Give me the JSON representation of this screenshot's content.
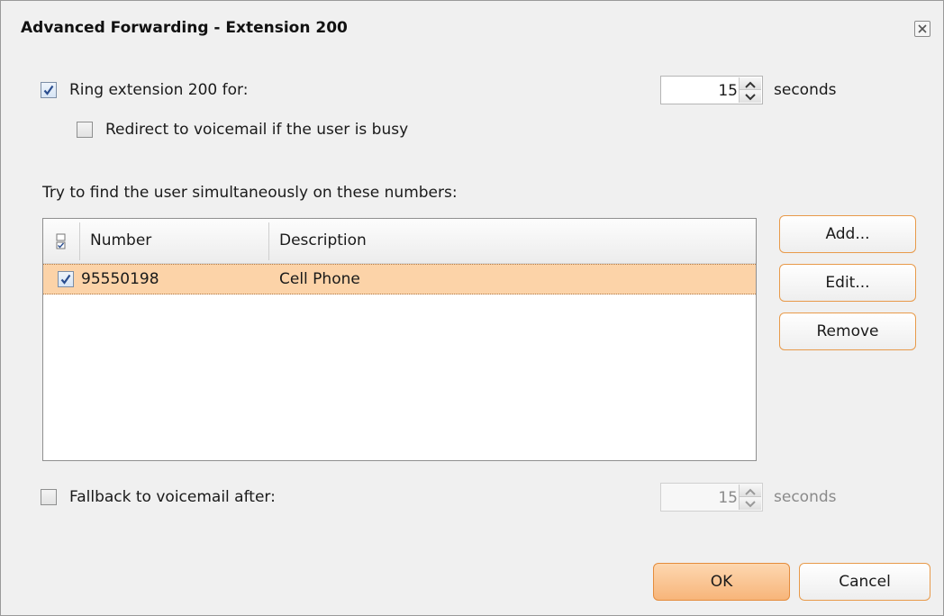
{
  "dialog": {
    "title": "Advanced Forwarding - Extension 200"
  },
  "ring": {
    "checked": true,
    "label": "Ring extension 200 for:",
    "seconds_value": "15",
    "seconds_unit": "seconds"
  },
  "redirect_busy": {
    "checked": false,
    "label": "Redirect to voicemail if the user is busy"
  },
  "simultaneous": {
    "heading": "Try to find the user simultaneously on these numbers:",
    "columns": [
      "Number",
      "Description"
    ],
    "rows": [
      {
        "checked": true,
        "number": "95550198",
        "description": "Cell Phone",
        "selected": true
      }
    ]
  },
  "side_buttons": {
    "add": "Add...",
    "edit": "Edit...",
    "remove": "Remove"
  },
  "fallback": {
    "checked": false,
    "label": "Fallback to voicemail after:",
    "seconds_value": "15",
    "seconds_unit": "seconds",
    "enabled": false
  },
  "footer": {
    "ok": "OK",
    "cancel": "Cancel"
  },
  "colors": {
    "accent_border": "#e89a4a",
    "selected_row": "#fcd3a8",
    "primary_button": "#f7b57a"
  }
}
